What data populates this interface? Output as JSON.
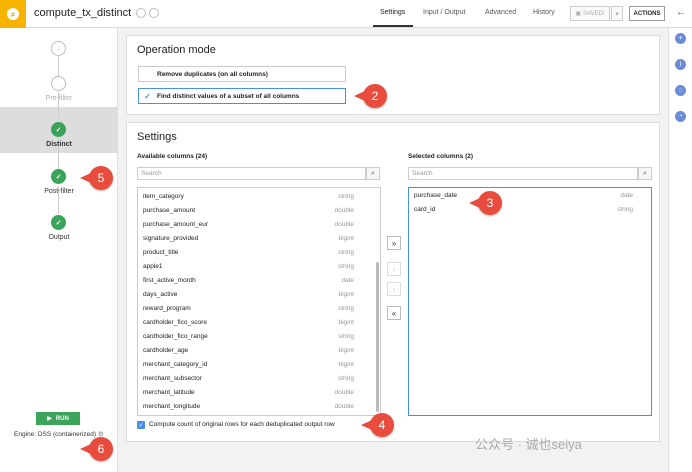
{
  "header": {
    "recipe_title": "compute_tx_distinct",
    "tabs": [
      {
        "label": "Settings",
        "active": true
      },
      {
        "label": "Input / Output",
        "active": false
      },
      {
        "label": "Advanced",
        "active": false
      },
      {
        "label": "History",
        "active": false
      }
    ],
    "saved_label": "SAVED!",
    "actions_label": "ACTIONS"
  },
  "steps": [
    {
      "label": "Pre-filter",
      "state": "pending"
    },
    {
      "label": "Distinct",
      "state": "done",
      "active": true
    },
    {
      "label": "Post-filter",
      "state": "done"
    },
    {
      "label": "Output",
      "state": "done"
    }
  ],
  "operation_mode": {
    "title": "Operation mode",
    "options": [
      {
        "label": "Remove duplicates (on all columns)",
        "selected": false
      },
      {
        "label": "Find distinct values of a subset of all columns",
        "selected": true
      }
    ]
  },
  "settings": {
    "title": "Settings",
    "available_heading": "Available columns (24)",
    "selected_heading": "Selected columns (2)",
    "search_placeholder": "Search",
    "available_columns": [
      {
        "name": "item_category",
        "type": "string"
      },
      {
        "name": "purchase_amount",
        "type": "double"
      },
      {
        "name": "purchase_amount_eur",
        "type": "double"
      },
      {
        "name": "signature_provided",
        "type": "bigint"
      },
      {
        "name": "product_title",
        "type": "string"
      },
      {
        "name": "apple1",
        "type": "string"
      },
      {
        "name": "first_active_month",
        "type": "date"
      },
      {
        "name": "days_active",
        "type": "bigint"
      },
      {
        "name": "reward_program",
        "type": "string"
      },
      {
        "name": "cardholder_fico_score",
        "type": "bigint"
      },
      {
        "name": "cardholder_fico_range",
        "type": "string"
      },
      {
        "name": "cardholder_age",
        "type": "bigint"
      },
      {
        "name": "merchant_category_id",
        "type": "bigint"
      },
      {
        "name": "merchant_subsector",
        "type": "string"
      },
      {
        "name": "merchant_latitude",
        "type": "double"
      },
      {
        "name": "merchant_longitude",
        "type": "double"
      }
    ],
    "selected_columns": [
      {
        "name": "purchase_date",
        "type": "date"
      },
      {
        "name": "card_id",
        "type": "string"
      }
    ],
    "move_buttons": {
      "add_all": "»",
      "add": "›",
      "remove": "‹",
      "remove_all": "«"
    },
    "count_checkbox_label": "Compute count of original rows for each deduplicated output row",
    "count_checked": true
  },
  "callouts": [
    "2",
    "3",
    "4",
    "5",
    "6"
  ],
  "footer": {
    "run_label": "RUN",
    "engine_label": "Engine: DSS (containerized)"
  },
  "watermark": "公众号 · 诚也seiya",
  "colors": {
    "accent": "#4a90e2",
    "success": "#3ba35a",
    "callout": "#e74c3c",
    "logo": "#f6b400"
  }
}
